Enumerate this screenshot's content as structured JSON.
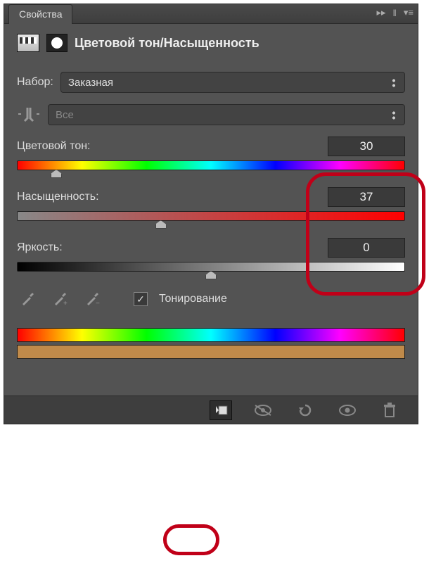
{
  "tab_title": "Свойства",
  "panel_title": "Цветовой тон/Насыщенность",
  "preset_label": "Набор:",
  "preset_value": "Заказная",
  "range_value": "Все",
  "hue": {
    "label": "Цветовой тон:",
    "value": "30",
    "thumb_pct": 10
  },
  "sat": {
    "label": "Насыщенность:",
    "value": "37",
    "thumb_pct": 37
  },
  "light": {
    "label": "Яркость:",
    "value": "0",
    "thumb_pct": 50
  },
  "colorize_label": "Тонирование",
  "colorize_checked": true,
  "result_color": "#c08a4a"
}
